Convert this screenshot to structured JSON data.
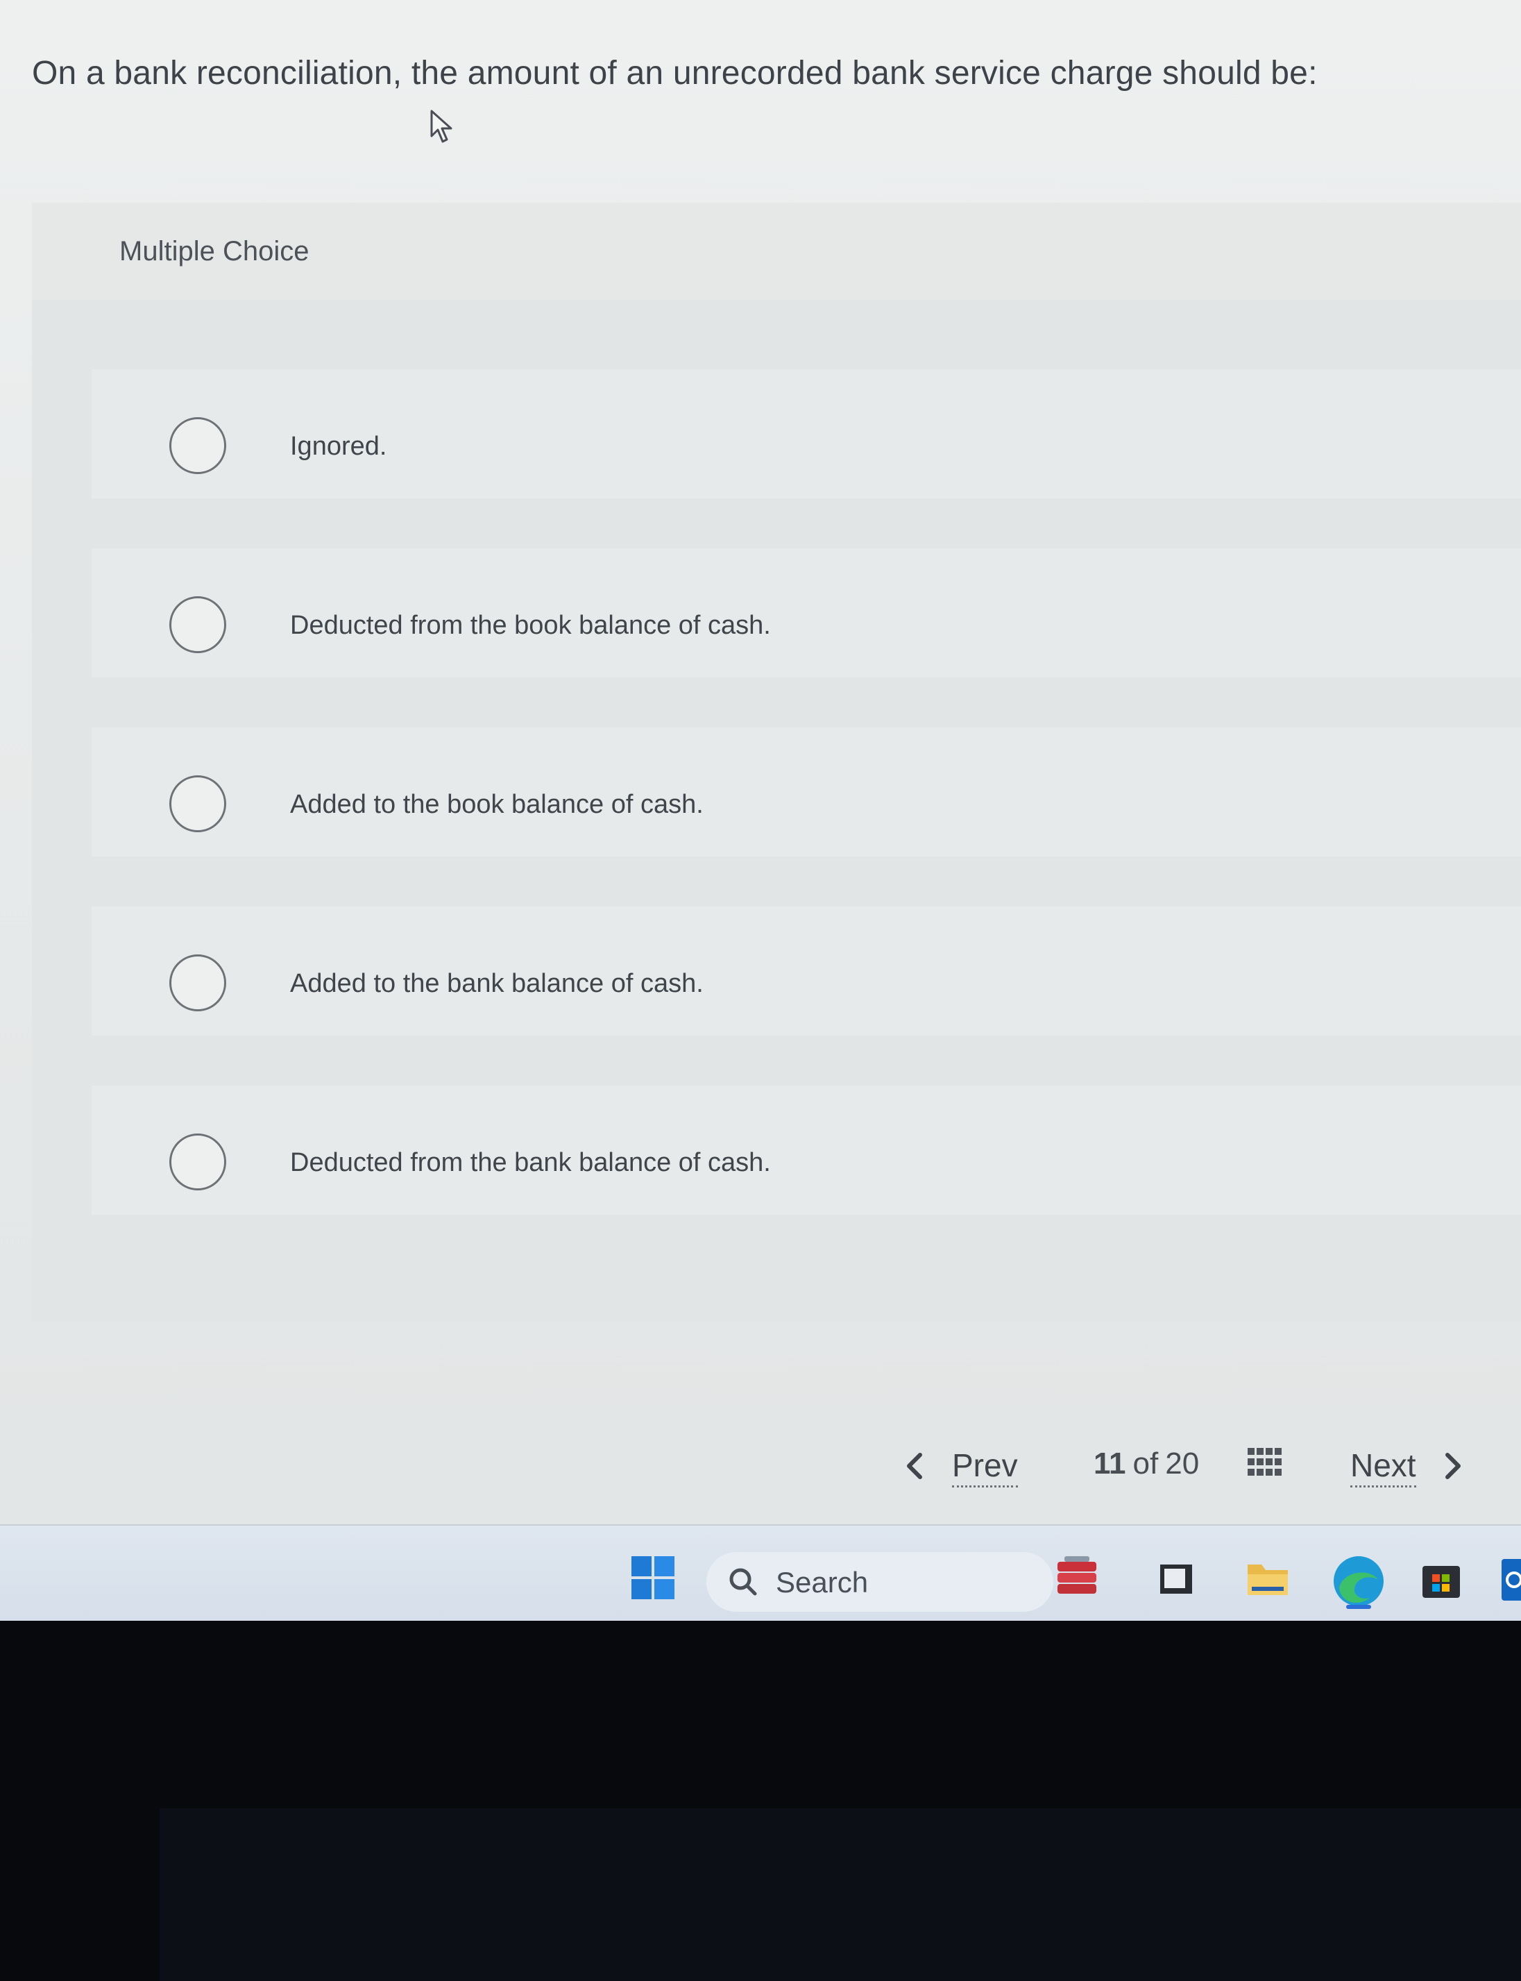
{
  "question": {
    "text": "On a bank reconciliation, the amount of an unrecorded bank service charge should be:"
  },
  "multiple_choice": {
    "title": "Multiple Choice",
    "options": [
      {
        "label": "Ignored."
      },
      {
        "label": "Deducted from the book balance of cash."
      },
      {
        "label": "Added to the book balance of cash."
      },
      {
        "label": "Added to the bank balance of cash."
      },
      {
        "label": "Deducted from the bank balance of cash."
      }
    ]
  },
  "navigation": {
    "prev_label": "Prev",
    "next_label": "Next",
    "current_page": "11",
    "of_label": "of",
    "total_pages": "20"
  },
  "taskbar": {
    "search_placeholder": "Search",
    "icons": [
      "windows-start-icon",
      "search-icon",
      "app-stack-icon",
      "window-icon",
      "folder-icon",
      "edge-browser-icon",
      "store-icon",
      "outlook-icon"
    ]
  }
}
